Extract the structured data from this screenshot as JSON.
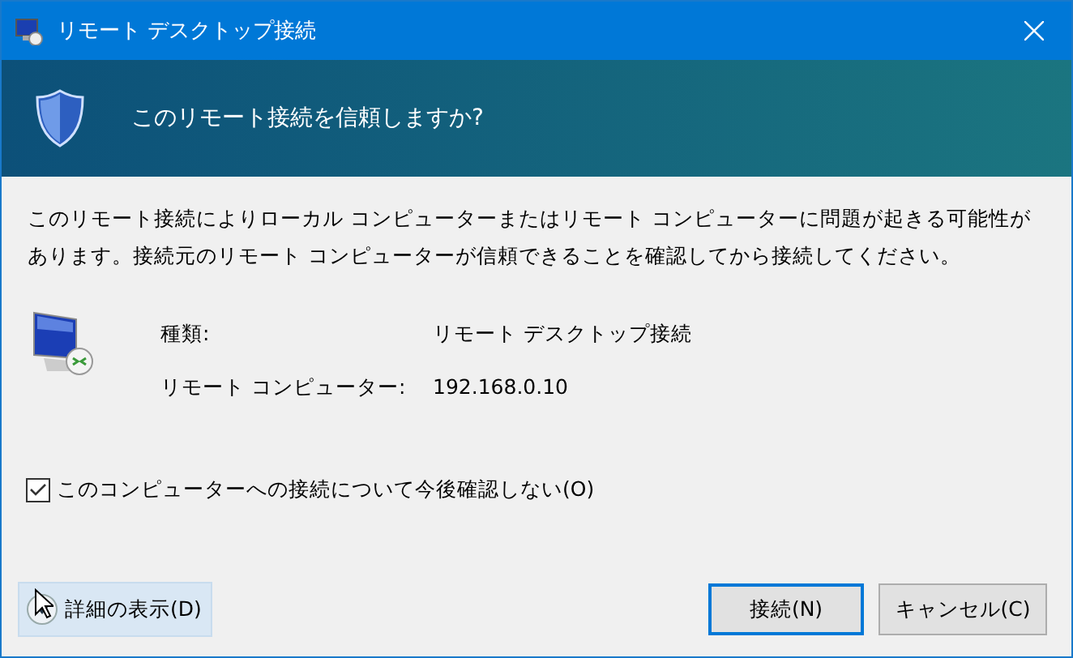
{
  "window": {
    "title": "リモート デスクトップ接続"
  },
  "banner": {
    "heading": "このリモート接続を信頼しますか?"
  },
  "message": "このリモート接続によりローカル コンピューターまたはリモート コンピューターに問題が起きる可能性があります。接続元のリモート コンピューターが信頼できることを確認してから接続してください。",
  "details": [
    {
      "label": "種類:",
      "value": "リモート デスクトップ接続"
    },
    {
      "label": "リモート コンピューター:",
      "value": "192.168.0.10"
    }
  ],
  "checkbox": {
    "label": "このコンピューターへの接続について今後確認しない(O)",
    "checked": true
  },
  "expander": {
    "label": "詳細の表示(D)",
    "expanded": false
  },
  "buttons": [
    {
      "label": "接続(N)",
      "default": true
    },
    {
      "label": "キャンセル(C)",
      "default": false
    }
  ]
}
